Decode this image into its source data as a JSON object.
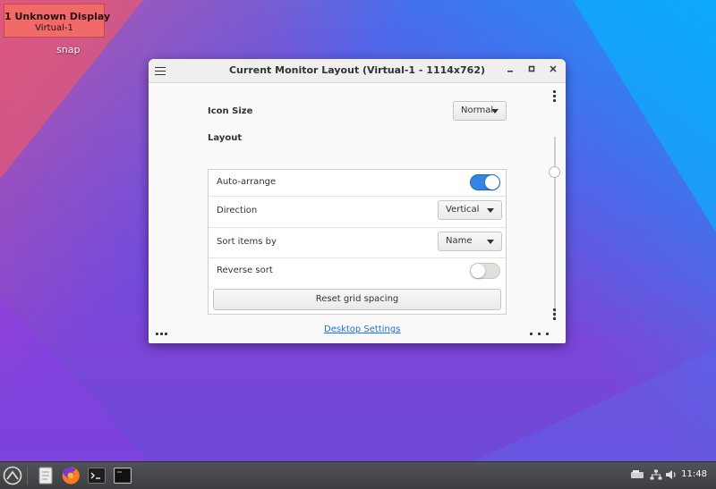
{
  "desktop": {
    "monitor_label_line1": "1  Unknown Display",
    "monitor_label_line2": "Virtual-1",
    "icon_label": "snap"
  },
  "window": {
    "title": "Current Monitor Layout (Virtual-1 - 1114x762)",
    "icon_size_label": "Icon Size",
    "icon_size_value": "Normal",
    "layout_heading": "Layout",
    "rows": {
      "auto_arrange": {
        "label": "Auto-arrange",
        "enabled": true
      },
      "direction": {
        "label": "Direction",
        "value": "Vertical"
      },
      "sort_items_by": {
        "label": "Sort items by",
        "value": "Name"
      },
      "reverse_sort": {
        "label": "Reverse sort",
        "enabled": false
      }
    },
    "reset_button": "Reset grid spacing",
    "desktop_settings_link": "Desktop Settings"
  },
  "taskbar": {
    "clock": "11:48",
    "launchers": [
      "app-menu-icon",
      "files-icon",
      "firefox-icon",
      "terminal-icon",
      "terminal-window-icon"
    ],
    "tray": [
      "display-icon",
      "network-icon",
      "volume-icon"
    ]
  }
}
